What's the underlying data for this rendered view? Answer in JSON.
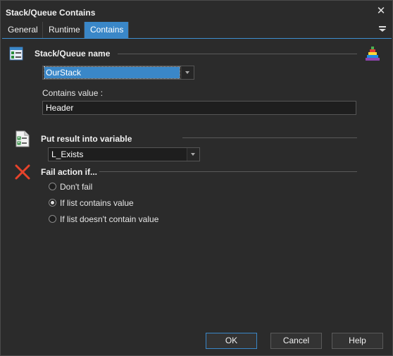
{
  "window": {
    "title": "Stack/Queue Contains",
    "close_glyph": "✕"
  },
  "tabs": [
    {
      "label": "General",
      "active": false
    },
    {
      "label": "Runtime",
      "active": false
    },
    {
      "label": "Contains",
      "active": true
    }
  ],
  "stack_section": {
    "title": "Stack/Queue name",
    "name_value": "OurStack",
    "contains_label": "Contains value :",
    "contains_value": "Header"
  },
  "result_section": {
    "title": "Put result into variable",
    "variable_value": "L_Exists"
  },
  "fail_section": {
    "title": "Fail action if...",
    "options": [
      {
        "label": "Don't fail",
        "checked": false
      },
      {
        "label": "If list contains value",
        "checked": true
      },
      {
        "label": "If list doesn't contain value",
        "checked": false
      }
    ]
  },
  "buttons": {
    "ok": "OK",
    "cancel": "Cancel",
    "help": "Help"
  },
  "icons": {
    "stack": "list-form-icon",
    "tower": "pyramid-stack-icon",
    "variable": "checklist-document-icon",
    "fail": "red-x-icon"
  },
  "colors": {
    "accent": "#3a87c8",
    "background": "#2b2b2b",
    "fail_red": "#e8432b"
  }
}
